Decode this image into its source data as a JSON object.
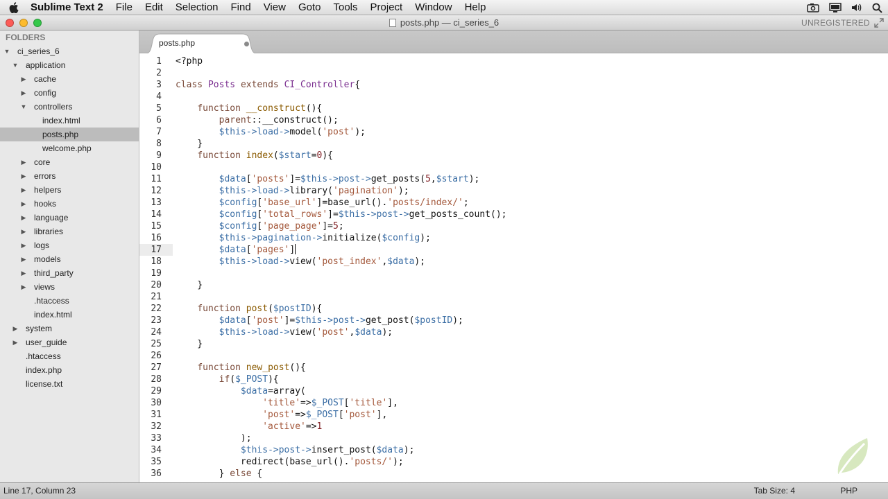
{
  "menubar": {
    "app_name": "Sublime Text 2",
    "items": [
      "File",
      "Edit",
      "Selection",
      "Find",
      "View",
      "Goto",
      "Tools",
      "Project",
      "Window",
      "Help"
    ],
    "status_icons": [
      "camera-icon",
      "display-icon",
      "volume-icon",
      "search-icon"
    ]
  },
  "window": {
    "title": "posts.php — ci_series_6",
    "registration": "UNREGISTERED",
    "traffic_colors": {
      "close": "#fc5b57",
      "minimize": "#fdbb2d",
      "zoom": "#35c84a"
    }
  },
  "sidebar": {
    "header": "FOLDERS",
    "items": [
      {
        "label": "ci_series_6",
        "depth": 0,
        "type": "folder",
        "open": true
      },
      {
        "label": "application",
        "depth": 1,
        "type": "folder",
        "open": true
      },
      {
        "label": "cache",
        "depth": 2,
        "type": "folder",
        "open": false
      },
      {
        "label": "config",
        "depth": 2,
        "type": "folder",
        "open": false
      },
      {
        "label": "controllers",
        "depth": 2,
        "type": "folder",
        "open": true
      },
      {
        "label": "index.html",
        "depth": 3,
        "type": "file"
      },
      {
        "label": "posts.php",
        "depth": 3,
        "type": "file",
        "selected": true
      },
      {
        "label": "welcome.php",
        "depth": 3,
        "type": "file"
      },
      {
        "label": "core",
        "depth": 2,
        "type": "folder",
        "open": false
      },
      {
        "label": "errors",
        "depth": 2,
        "type": "folder",
        "open": false
      },
      {
        "label": "helpers",
        "depth": 2,
        "type": "folder",
        "open": false
      },
      {
        "label": "hooks",
        "depth": 2,
        "type": "folder",
        "open": false
      },
      {
        "label": "language",
        "depth": 2,
        "type": "folder",
        "open": false
      },
      {
        "label": "libraries",
        "depth": 2,
        "type": "folder",
        "open": false
      },
      {
        "label": "logs",
        "depth": 2,
        "type": "folder",
        "open": false
      },
      {
        "label": "models",
        "depth": 2,
        "type": "folder",
        "open": false
      },
      {
        "label": "third_party",
        "depth": 2,
        "type": "folder",
        "open": false
      },
      {
        "label": "views",
        "depth": 2,
        "type": "folder",
        "open": false
      },
      {
        "label": ".htaccess",
        "depth": 2,
        "type": "file"
      },
      {
        "label": "index.html",
        "depth": 2,
        "type": "file"
      },
      {
        "label": "system",
        "depth": 1,
        "type": "folder",
        "open": false
      },
      {
        "label": "user_guide",
        "depth": 1,
        "type": "folder",
        "open": false
      },
      {
        "label": ".htaccess",
        "depth": 1,
        "type": "file"
      },
      {
        "label": "index.php",
        "depth": 1,
        "type": "file"
      },
      {
        "label": "license.txt",
        "depth": 1,
        "type": "file"
      }
    ]
  },
  "tab": {
    "label": "posts.php",
    "dirty": true
  },
  "editor": {
    "current_line": 17,
    "lines": [
      [
        [
          "t",
          "<?php"
        ]
      ],
      [],
      [
        [
          "kw",
          "class"
        ],
        [
          "t",
          " "
        ],
        [
          "cls",
          "Posts"
        ],
        [
          "t",
          " "
        ],
        [
          "kw",
          "extends"
        ],
        [
          "t",
          " "
        ],
        [
          "cls",
          "CI_Controller"
        ],
        [
          "t",
          "{"
        ]
      ],
      [],
      [
        [
          "t",
          "    "
        ],
        [
          "kw",
          "function"
        ],
        [
          "t",
          " "
        ],
        [
          "fn",
          "__construct"
        ],
        [
          "t",
          "(){"
        ]
      ],
      [
        [
          "t",
          "        "
        ],
        [
          "kw",
          "parent"
        ],
        [
          "t",
          "::__construct();"
        ]
      ],
      [
        [
          "t",
          "        "
        ],
        [
          "vr",
          "$this"
        ],
        [
          "arrow-op",
          "->"
        ],
        [
          "vr",
          "load"
        ],
        [
          "arrow-op",
          "->"
        ],
        [
          "t",
          "model("
        ],
        [
          "st",
          "'post'"
        ],
        [
          "t",
          ");"
        ]
      ],
      [
        [
          "t",
          "    }"
        ]
      ],
      [
        [
          "t",
          "    "
        ],
        [
          "kw",
          "function"
        ],
        [
          "t",
          " "
        ],
        [
          "fn",
          "index"
        ],
        [
          "t",
          "("
        ],
        [
          "vr",
          "$start"
        ],
        [
          "t",
          "="
        ],
        [
          "num",
          "0"
        ],
        [
          "t",
          "){"
        ]
      ],
      [],
      [
        [
          "t",
          "        "
        ],
        [
          "vr",
          "$data"
        ],
        [
          "t",
          "["
        ],
        [
          "st",
          "'posts'"
        ],
        [
          "t",
          "]="
        ],
        [
          "vr",
          "$this"
        ],
        [
          "arrow-op",
          "->"
        ],
        [
          "vr",
          "post"
        ],
        [
          "arrow-op",
          "->"
        ],
        [
          "t",
          "get_posts("
        ],
        [
          "num",
          "5"
        ],
        [
          "t",
          ","
        ],
        [
          "vr",
          "$start"
        ],
        [
          "t",
          ");"
        ]
      ],
      [
        [
          "t",
          "        "
        ],
        [
          "vr",
          "$this"
        ],
        [
          "arrow-op",
          "->"
        ],
        [
          "vr",
          "load"
        ],
        [
          "arrow-op",
          "->"
        ],
        [
          "t",
          "library("
        ],
        [
          "st",
          "'pagination'"
        ],
        [
          "t",
          ");"
        ]
      ],
      [
        [
          "t",
          "        "
        ],
        [
          "vr",
          "$config"
        ],
        [
          "t",
          "["
        ],
        [
          "st",
          "'base_url'"
        ],
        [
          "t",
          "]=base_url()."
        ],
        [
          "st",
          "'posts/index/'"
        ],
        [
          "t",
          ";"
        ]
      ],
      [
        [
          "t",
          "        "
        ],
        [
          "vr",
          "$config"
        ],
        [
          "t",
          "["
        ],
        [
          "st",
          "'total_rows'"
        ],
        [
          "t",
          "]="
        ],
        [
          "vr",
          "$this"
        ],
        [
          "arrow-op",
          "->"
        ],
        [
          "vr",
          "post"
        ],
        [
          "arrow-op",
          "->"
        ],
        [
          "t",
          "get_posts_count();"
        ]
      ],
      [
        [
          "t",
          "        "
        ],
        [
          "vr",
          "$config"
        ],
        [
          "t",
          "["
        ],
        [
          "st",
          "'page_page'"
        ],
        [
          "t",
          "]="
        ],
        [
          "num",
          "5"
        ],
        [
          "t",
          ";"
        ]
      ],
      [
        [
          "t",
          "        "
        ],
        [
          "vr",
          "$this"
        ],
        [
          "arrow-op",
          "->"
        ],
        [
          "vr",
          "pagination"
        ],
        [
          "arrow-op",
          "->"
        ],
        [
          "t",
          "initialize("
        ],
        [
          "vr",
          "$config"
        ],
        [
          "t",
          ");"
        ]
      ],
      [
        [
          "t",
          "        "
        ],
        [
          "vr",
          "$data"
        ],
        [
          "t",
          "["
        ],
        [
          "st",
          "'pages'"
        ],
        [
          "t",
          "]"
        ],
        [
          "caret",
          ""
        ]
      ],
      [
        [
          "t",
          "        "
        ],
        [
          "vr",
          "$this"
        ],
        [
          "arrow-op",
          "->"
        ],
        [
          "vr",
          "load"
        ],
        [
          "arrow-op",
          "->"
        ],
        [
          "t",
          "view("
        ],
        [
          "st",
          "'post_index'"
        ],
        [
          "t",
          ","
        ],
        [
          "vr",
          "$data"
        ],
        [
          "t",
          ");"
        ]
      ],
      [],
      [
        [
          "t",
          "    }"
        ]
      ],
      [],
      [
        [
          "t",
          "    "
        ],
        [
          "kw",
          "function"
        ],
        [
          "t",
          " "
        ],
        [
          "fn",
          "post"
        ],
        [
          "t",
          "("
        ],
        [
          "vr",
          "$postID"
        ],
        [
          "t",
          "){"
        ]
      ],
      [
        [
          "t",
          "        "
        ],
        [
          "vr",
          "$data"
        ],
        [
          "t",
          "["
        ],
        [
          "st",
          "'post'"
        ],
        [
          "t",
          "]="
        ],
        [
          "vr",
          "$this"
        ],
        [
          "arrow-op",
          "->"
        ],
        [
          "vr",
          "post"
        ],
        [
          "arrow-op",
          "->"
        ],
        [
          "t",
          "get_post("
        ],
        [
          "vr",
          "$postID"
        ],
        [
          "t",
          ");"
        ]
      ],
      [
        [
          "t",
          "        "
        ],
        [
          "vr",
          "$this"
        ],
        [
          "arrow-op",
          "->"
        ],
        [
          "vr",
          "load"
        ],
        [
          "arrow-op",
          "->"
        ],
        [
          "t",
          "view("
        ],
        [
          "st",
          "'post'"
        ],
        [
          "t",
          ","
        ],
        [
          "vr",
          "$data"
        ],
        [
          "t",
          ");"
        ]
      ],
      [
        [
          "t",
          "    }"
        ]
      ],
      [],
      [
        [
          "t",
          "    "
        ],
        [
          "kw",
          "function"
        ],
        [
          "t",
          " "
        ],
        [
          "fn",
          "new_post"
        ],
        [
          "t",
          "(){"
        ]
      ],
      [
        [
          "t",
          "        "
        ],
        [
          "kw",
          "if"
        ],
        [
          "t",
          "("
        ],
        [
          "vr",
          "$_POST"
        ],
        [
          "t",
          "){"
        ]
      ],
      [
        [
          "t",
          "            "
        ],
        [
          "vr",
          "$data"
        ],
        [
          "t",
          "=array("
        ]
      ],
      [
        [
          "t",
          "                "
        ],
        [
          "st",
          "'title'"
        ],
        [
          "t",
          "=>"
        ],
        [
          "vr",
          "$_POST"
        ],
        [
          "t",
          "["
        ],
        [
          "st",
          "'title'"
        ],
        [
          "t",
          "],"
        ]
      ],
      [
        [
          "t",
          "                "
        ],
        [
          "st",
          "'post'"
        ],
        [
          "t",
          "=>"
        ],
        [
          "vr",
          "$_POST"
        ],
        [
          "t",
          "["
        ],
        [
          "st",
          "'post'"
        ],
        [
          "t",
          "],"
        ]
      ],
      [
        [
          "t",
          "                "
        ],
        [
          "st",
          "'active'"
        ],
        [
          "t",
          "=>"
        ],
        [
          "num",
          "1"
        ]
      ],
      [
        [
          "t",
          "            );"
        ]
      ],
      [
        [
          "t",
          "            "
        ],
        [
          "vr",
          "$this"
        ],
        [
          "arrow-op",
          "->"
        ],
        [
          "vr",
          "post"
        ],
        [
          "arrow-op",
          "->"
        ],
        [
          "t",
          "insert_post("
        ],
        [
          "vr",
          "$data"
        ],
        [
          "t",
          ");"
        ]
      ],
      [
        [
          "t",
          "            redirect(base_url()."
        ],
        [
          "st",
          "'posts/'"
        ],
        [
          "t",
          ");"
        ]
      ],
      [
        [
          "t",
          "        } "
        ],
        [
          "kw",
          "else"
        ],
        [
          "t",
          " {"
        ]
      ]
    ]
  },
  "statusbar": {
    "position": "Line 17, Column 23",
    "tab_size": "Tab Size: 4",
    "syntax": "PHP"
  }
}
